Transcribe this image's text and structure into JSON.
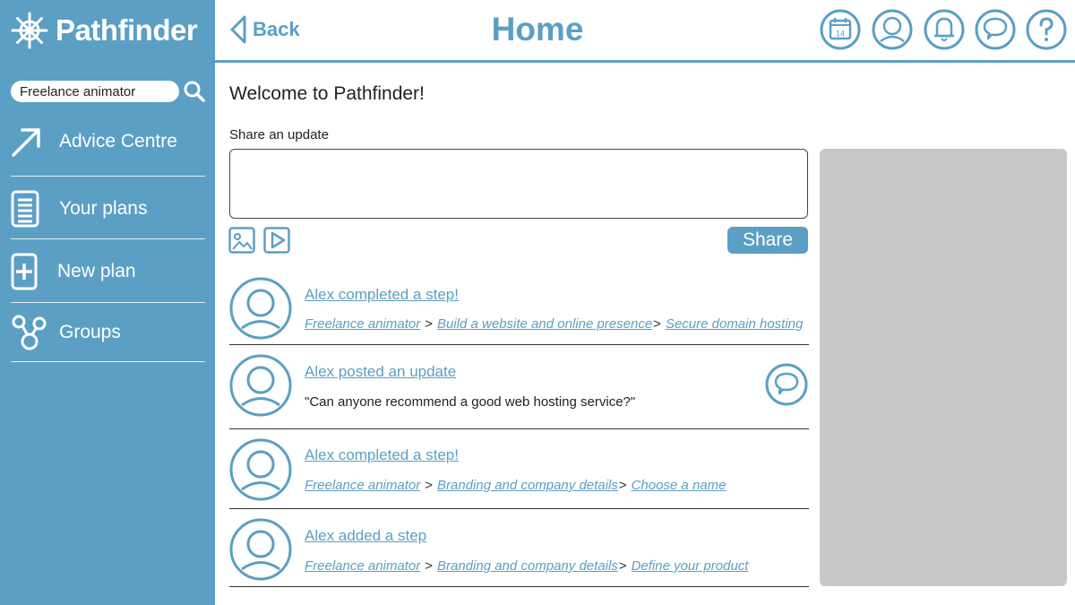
{
  "app": {
    "name": "Pathfinder"
  },
  "sidebar": {
    "search_value": "Freelance animator",
    "items": [
      {
        "label": "Advice Centre",
        "icon": "arrow-up-right-icon"
      },
      {
        "label": "Your plans",
        "icon": "document-list-icon"
      },
      {
        "label": "New plan",
        "icon": "plus-box-icon"
      },
      {
        "label": "Groups",
        "icon": "groups-icon"
      }
    ]
  },
  "header": {
    "back_label": "Back",
    "title": "Home",
    "calendar_day": "14",
    "icons": [
      "calendar-icon",
      "profile-icon",
      "bell-icon",
      "chat-icon",
      "help-icon"
    ]
  },
  "main": {
    "welcome": "Welcome to Pathfinder!",
    "share_label": "Share an update",
    "share_value": "",
    "share_button": "Share",
    "feed": [
      {
        "title": "Alex completed a step!",
        "crumbs": [
          "Freelance animator",
          "Build a website and online presence",
          "Secure domain hosting"
        ]
      },
      {
        "title": "Alex posted an update",
        "quote": "\"Can anyone recommend a good web hosting service?\""
      },
      {
        "title": "Alex completed a step!",
        "crumbs": [
          "Freelance animator",
          "Branding and company details",
          "Choose a name"
        ]
      },
      {
        "title": "Alex added a step",
        "crumbs": [
          "Freelance animator",
          "Branding and company details",
          "Define your product"
        ]
      }
    ],
    "crumb_separator": ">"
  },
  "colors": {
    "accent": "#5b9fc4",
    "panel": "#c8c8c8",
    "text": "#222222"
  }
}
